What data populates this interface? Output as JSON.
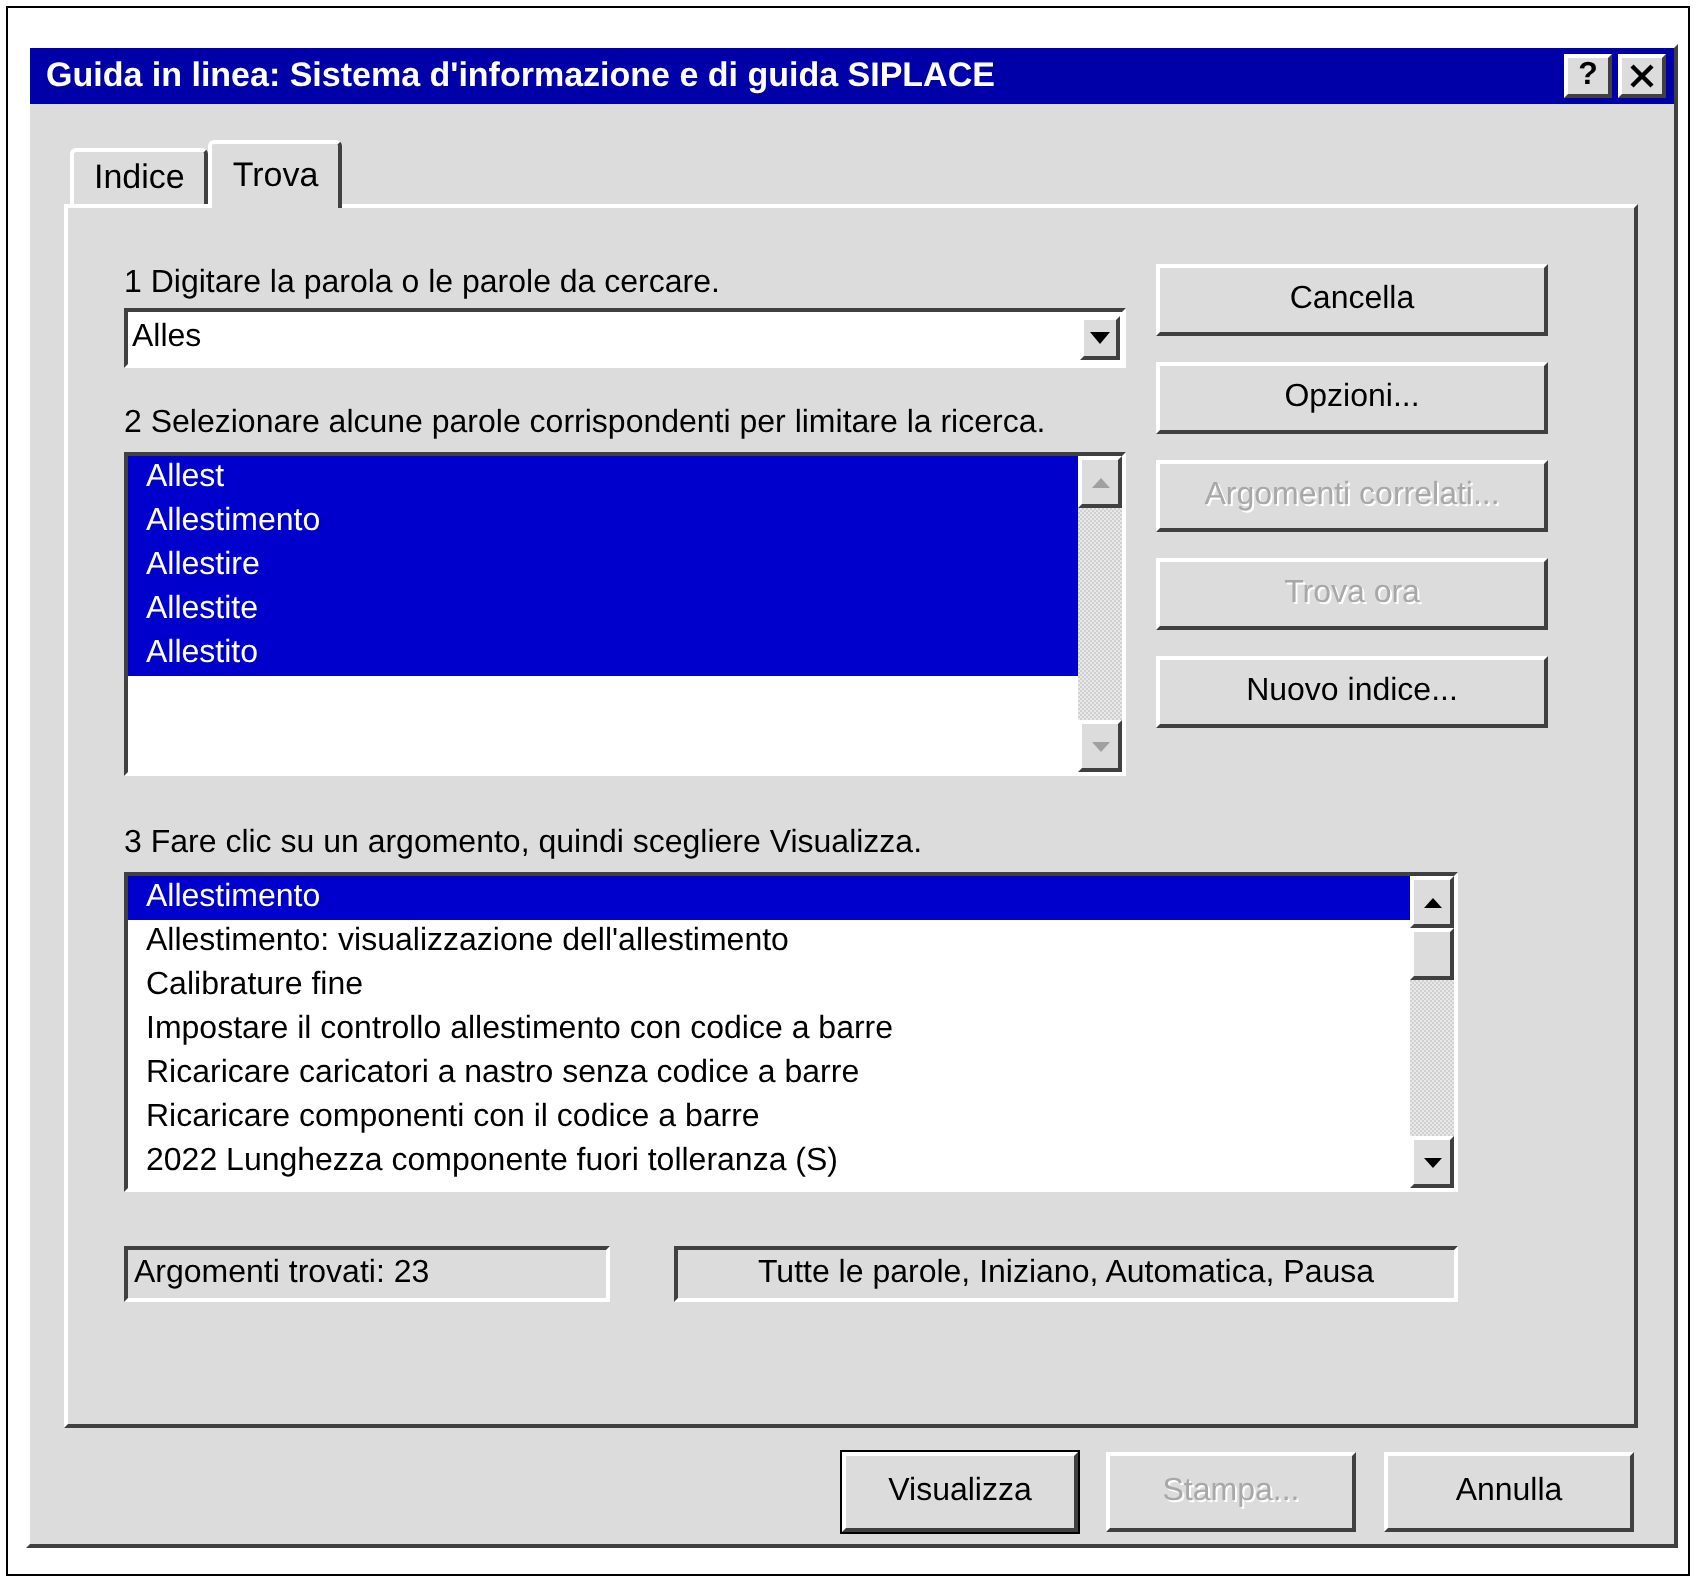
{
  "window": {
    "title": "Guida in linea: Sistema d'informazione e di guida SIPLACE",
    "help_button": "?"
  },
  "tabs": [
    {
      "label": "Indice",
      "selected": false
    },
    {
      "label": "Trova",
      "selected": true
    }
  ],
  "step_1": {
    "label": "1 Digitare la parola o le parole da cercare.",
    "value": "Alles"
  },
  "step_2": {
    "label": "2 Selezionare alcune parole corrispondenti per limitare la ricerca.",
    "words": [
      {
        "text": "Allest",
        "selected": true
      },
      {
        "text": "Allestimento",
        "selected": true
      },
      {
        "text": "Allestire",
        "selected": true
      },
      {
        "text": "Allestite",
        "selected": true
      },
      {
        "text": "Allestito",
        "selected": true
      }
    ]
  },
  "side_buttons": [
    {
      "label": "Cancella",
      "disabled": false
    },
    {
      "label": "Opzioni...",
      "disabled": false
    },
    {
      "label": "Argomenti correlati...",
      "disabled": true
    },
    {
      "label": "Trova ora",
      "disabled": true
    },
    {
      "label": "Nuovo indice...",
      "disabled": false
    }
  ],
  "step_3": {
    "label": "3 Fare clic su un argomento, quindi scegliere Visualizza.",
    "topics": [
      {
        "text": "Allestimento",
        "selected": true
      },
      {
        "text": "Allestimento: visualizzazione dell'allestimento",
        "selected": false
      },
      {
        "text": "Calibrature fine",
        "selected": false
      },
      {
        "text": "Impostare il controllo allestimento con codice a barre",
        "selected": false
      },
      {
        "text": "Ricaricare caricatori a nastro senza codice a barre",
        "selected": false
      },
      {
        "text": "Ricaricare componenti con il codice a barre",
        "selected": false
      },
      {
        "text": "2022 Lunghezza componente fuori tolleranza (S)",
        "selected": false
      }
    ]
  },
  "status": {
    "found": "Argomenti trovati: 23",
    "options": "Tutte le parole, Iniziano, Automatica, Pausa"
  },
  "footer_buttons": [
    {
      "label": "Visualizza",
      "disabled": false,
      "default": true
    },
    {
      "label": "Stampa...",
      "disabled": true,
      "default": false
    },
    {
      "label": "Annulla",
      "disabled": false,
      "default": false
    }
  ]
}
